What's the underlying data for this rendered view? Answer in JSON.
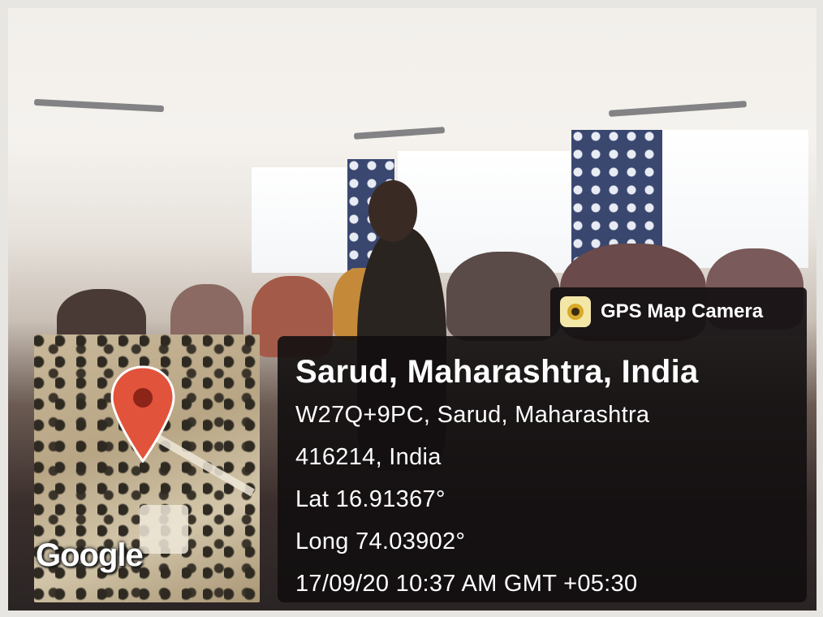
{
  "watermark": {
    "app_name": "GPS Map Camera",
    "app_icon": "gps-map-camera-app-icon",
    "map_provider": "Google",
    "map_pin": "red-location-pin-icon"
  },
  "location": {
    "title": "Sarud, Maharashtra, India",
    "address_line1": "W27Q+9PC, Sarud, Maharashtra",
    "address_line2": "416214, India",
    "latitude": "Lat 16.91367°",
    "longitude": "Long 74.03902°",
    "timestamp": "17/09/20 10:37 AM GMT +05:30"
  },
  "colors": {
    "overlay": "#141012",
    "pin": "#e2533b",
    "text": "#ffffff"
  }
}
